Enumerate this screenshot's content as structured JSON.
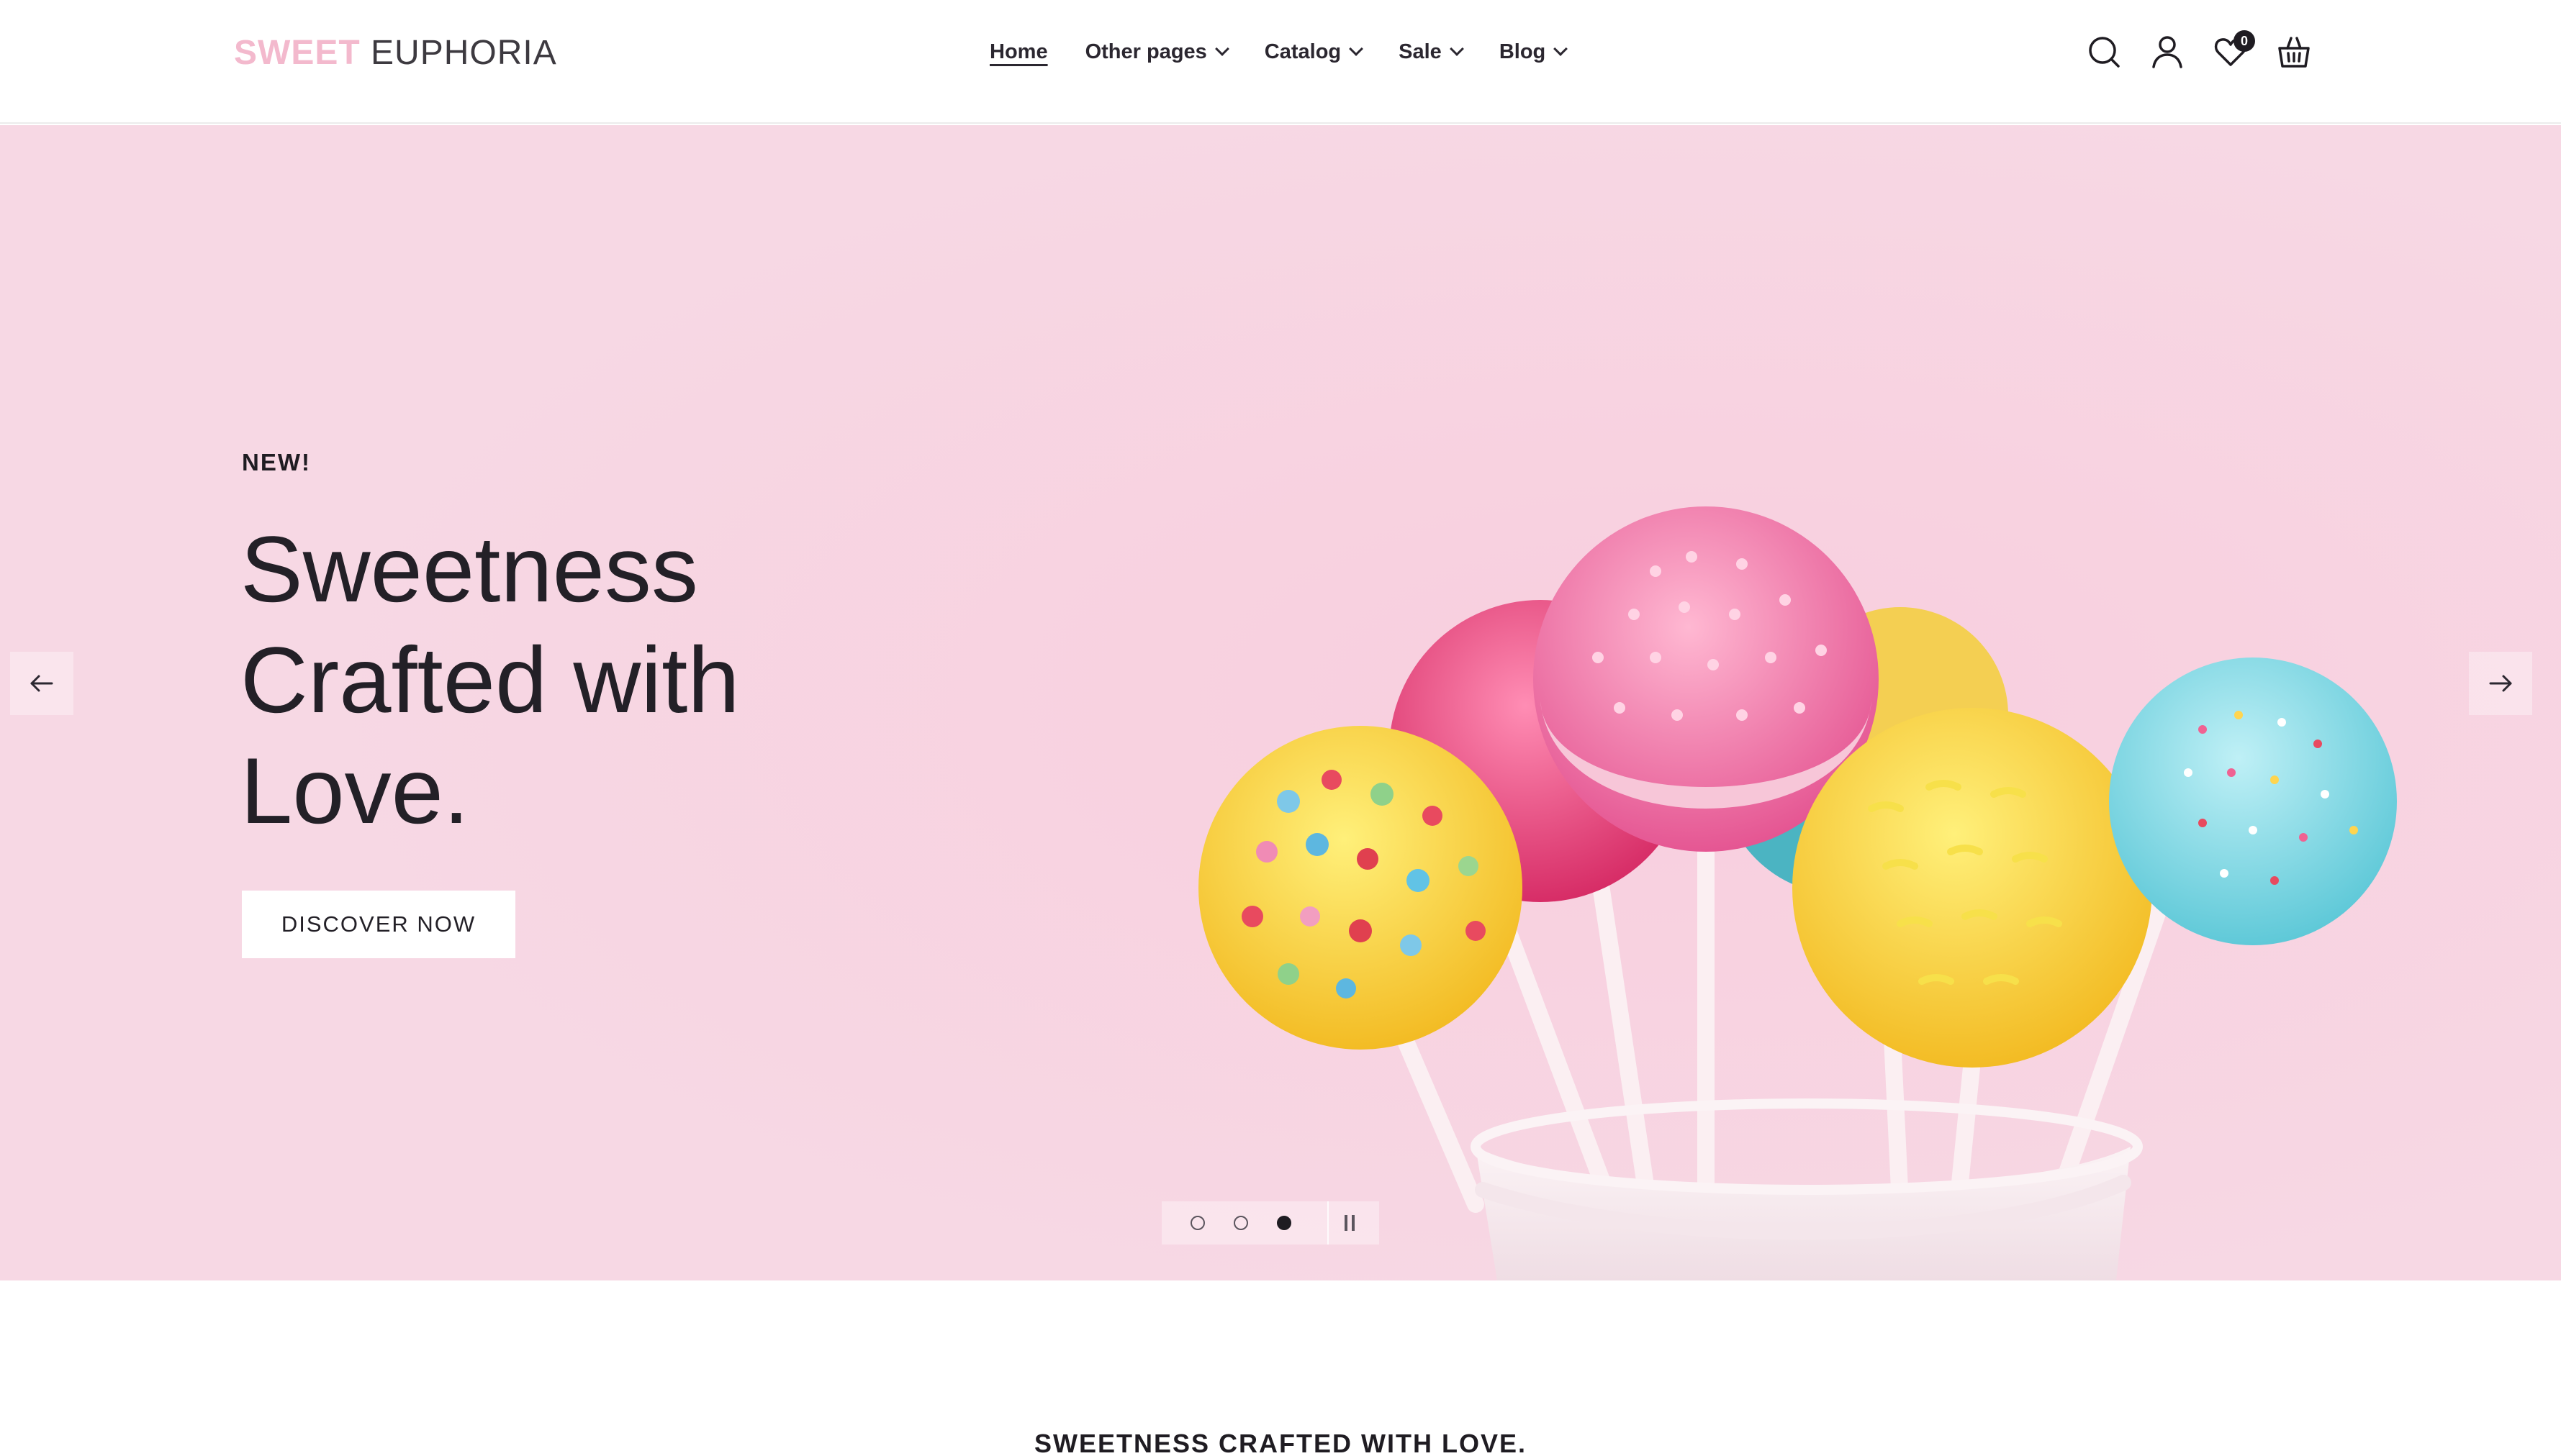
{
  "brand": {
    "part1": "SWEET",
    "part2": "EUPHORIA"
  },
  "nav": [
    {
      "label": "Home",
      "active": true,
      "dropdown": false
    },
    {
      "label": "Other pages",
      "active": false,
      "dropdown": true
    },
    {
      "label": "Catalog",
      "active": false,
      "dropdown": true
    },
    {
      "label": "Sale",
      "active": false,
      "dropdown": true
    },
    {
      "label": "Blog",
      "active": false,
      "dropdown": true
    }
  ],
  "header_icons": {
    "search": "search-icon",
    "account": "user-icon",
    "wishlist": "heart-icon",
    "wishlist_count": "0",
    "cart": "basket-icon"
  },
  "hero": {
    "eyebrow": "NEW!",
    "title_lines": [
      "Sweetness",
      "Crafted with",
      "Love."
    ],
    "cta_label": "DISCOVER NOW",
    "slides_total": 3,
    "active_slide": 3
  },
  "colors": {
    "hero_background": "#f7d8e4",
    "brand_accent": "#f3b9cd",
    "text_dark": "#1f1c22"
  },
  "section": {
    "heading": "SWEETNESS CRAFTED WITH LOVE."
  }
}
